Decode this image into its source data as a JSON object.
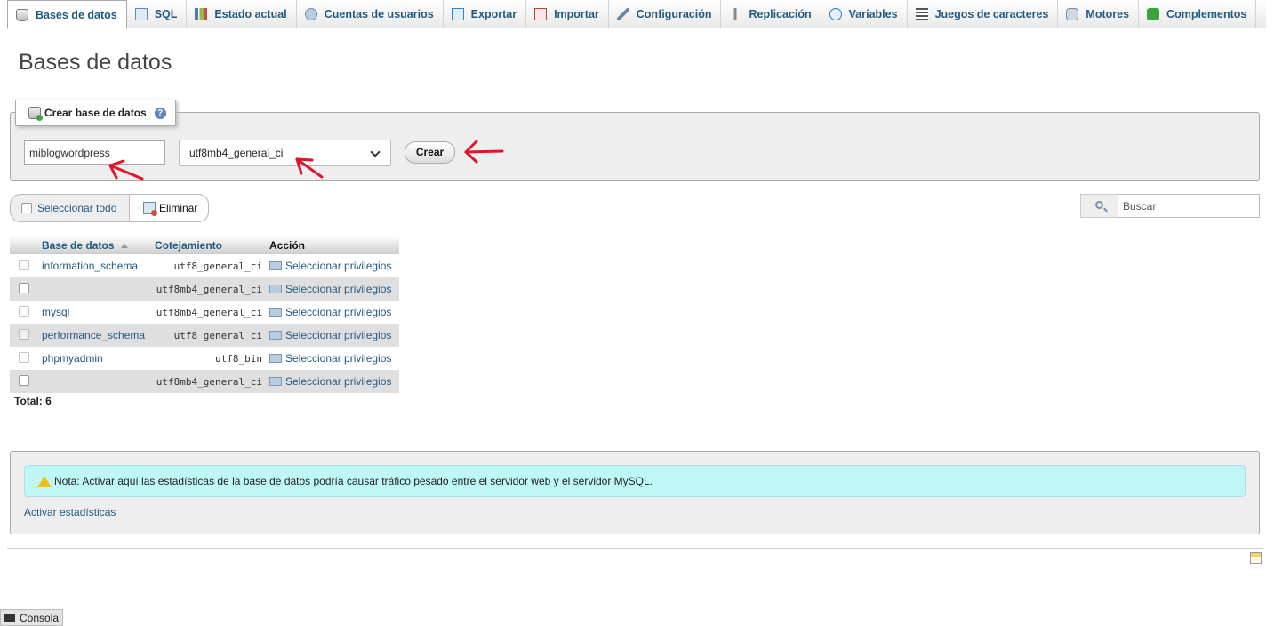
{
  "tabs": [
    {
      "label": "Bases de datos",
      "icon": "database-icon",
      "active": true
    },
    {
      "label": "SQL",
      "icon": "sql-icon"
    },
    {
      "label": "Estado actual",
      "icon": "status-icon"
    },
    {
      "label": "Cuentas de usuarios",
      "icon": "users-icon"
    },
    {
      "label": "Exportar",
      "icon": "export-icon"
    },
    {
      "label": "Importar",
      "icon": "import-icon"
    },
    {
      "label": "Configuración",
      "icon": "wrench-icon"
    },
    {
      "label": "Replicación",
      "icon": "replication-icon"
    },
    {
      "label": "Variables",
      "icon": "variables-icon"
    },
    {
      "label": "Juegos de caracteres",
      "icon": "charset-icon"
    },
    {
      "label": "Motores",
      "icon": "engines-icon"
    },
    {
      "label": "Complementos",
      "icon": "plugin-icon"
    }
  ],
  "page_title": "Bases de datos",
  "create": {
    "legend": "Crear base de datos",
    "help_glyph": "?",
    "db_name_value": "miblogwordpress",
    "collation_value": "utf8mb4_general_ci",
    "create_label": "Crear"
  },
  "toolbar": {
    "select_all_label": "Seleccionar todo",
    "delete_label": "Eliminar",
    "search_placeholder": "Buscar"
  },
  "table": {
    "headers": {
      "database": "Base de datos",
      "collation": "Cotejamiento",
      "action": "Acción"
    },
    "rows": [
      {
        "name": "information_schema",
        "collation": "utf8_general_ci",
        "action": "Seleccionar privilegios"
      },
      {
        "name": "",
        "collation": "utf8mb4_general_ci",
        "action": "Seleccionar privilegios"
      },
      {
        "name": "mysql",
        "collation": "utf8mb4_general_ci",
        "action": "Seleccionar privilegios"
      },
      {
        "name": "performance_schema",
        "collation": "utf8_general_ci",
        "action": "Seleccionar privilegios"
      },
      {
        "name": "phpmyadmin",
        "collation": "utf8_bin",
        "action": "Seleccionar privilegios"
      },
      {
        "name": "",
        "collation": "utf8mb4_general_ci",
        "action": "Seleccionar privilegios"
      }
    ],
    "total": "Total: 6"
  },
  "stats": {
    "notice": "Nota: Activar aquí las estadísticas de la base de datos podría causar tráfico pesado entre el servidor web y el servidor MySQL.",
    "enable_link": "Activar estadísticas"
  },
  "console_label": "Consola",
  "colors": {
    "link": "#235a81",
    "annotation_arrow": "#e0152b",
    "notice_bg": "#bff7f7"
  }
}
